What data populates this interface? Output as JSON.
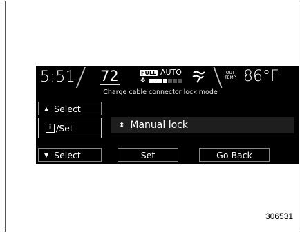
{
  "status": {
    "time": "5:51",
    "set_temp": "72",
    "full_badge": "FULL",
    "mode": "AUTO",
    "fan_icon": "fan-icon",
    "fan_level": 4,
    "fan_max": 7,
    "airflow_icon": "airflow-mode-icon",
    "out_temp_label_1": "OUT",
    "out_temp_label_2": "TEMP",
    "out_temp": "86°F"
  },
  "screen": {
    "title": "Charge cable connector lock mode",
    "option_value": "Manual lock"
  },
  "buttons": {
    "select_up": "Select",
    "info_set": "/Set",
    "info_glyph": "i",
    "select_down": "Select",
    "set": "Set",
    "go_back": "Go Back"
  },
  "figure_id": "306531",
  "colors": {
    "screen_bg": "#000000",
    "text": "#ffffff",
    "fan_on": "#ffffff",
    "fan_off": "#555555"
  }
}
